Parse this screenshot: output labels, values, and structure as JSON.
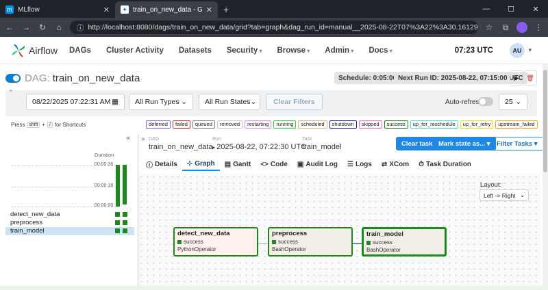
{
  "browser": {
    "tabs": [
      {
        "title": "MLflow",
        "active": false
      },
      {
        "title": "train_on_new_data - Grid - Airfl",
        "active": true
      }
    ],
    "url": "http://localhost:8080/dags/train_on_new_data/grid?tab=graph&dag_run_id=manual__2025-08-22T07%3A22%3A30.161297%2B00%3A00&task_i..."
  },
  "nav": {
    "brand": "Airflow",
    "items": [
      "DAGs",
      "Cluster Activity",
      "Datasets",
      "Security",
      "Browse",
      "Admin",
      "Docs"
    ],
    "dropdown_items": [
      "Security",
      "Browse",
      "Admin",
      "Docs"
    ],
    "time": "07:23 UTC",
    "user_initials": "AU"
  },
  "dag": {
    "label": "DAG:",
    "name": "train_on_new_data",
    "schedule": "Schedule: 0:05:00",
    "next_run": "Next Run ID: 2025-08-22, 07:15:00 UTC"
  },
  "filters": {
    "date": "08/22/2025 07:22:31 AM",
    "run_types": "All Run Types",
    "run_states": "All Run States",
    "clear": "Clear Filters",
    "auto_refresh": "Auto-refresh",
    "page_size": "25"
  },
  "shortcut": {
    "press": "Press",
    "key1": "shift",
    "plus": "+",
    "key2": "/",
    "suffix": "for Shortcuts"
  },
  "legend": [
    {
      "label": "deferred",
      "color": "#7b68ee"
    },
    {
      "label": "failed",
      "color": "#d62728"
    },
    {
      "label": "queued",
      "color": "#808080"
    },
    {
      "label": "removed",
      "color": "#c8c8c8"
    },
    {
      "label": "restarting",
      "color": "#ee82ee"
    },
    {
      "label": "running",
      "color": "#32cd32"
    },
    {
      "label": "scheduled",
      "color": "#d2b48c"
    },
    {
      "label": "shutdown",
      "color": "#1a1ab0"
    },
    {
      "label": "skipped",
      "color": "#ff69b4"
    },
    {
      "label": "success",
      "color": "#1a8a1a"
    },
    {
      "label": "up_for_reschedule",
      "color": "#40e0d0"
    },
    {
      "label": "up_for_retry",
      "color": "#ffd700"
    },
    {
      "label": "upstream_failed",
      "color": "#ffa500"
    },
    {
      "label": "no_status",
      "color": ""
    }
  ],
  "grid": {
    "duration_label": "Duration",
    "ticks": [
      "00:00:36",
      "00:00:18",
      "00:00:00"
    ],
    "tasks": [
      "detect_new_data",
      "preprocess",
      "train_model"
    ],
    "selected_task": "train_model",
    "run_count": 2
  },
  "details": {
    "crumbs": [
      {
        "label": "DAG",
        "value": "train_on_new_data"
      },
      {
        "label": "Run",
        "value": "2025-08-22, 07:22:30 UTC"
      },
      {
        "label": "Task",
        "value": "train_model"
      }
    ],
    "clear_task": "Clear task",
    "mark_state": "Mark state as...",
    "filter_tasks": "Filter Tasks",
    "tabs": [
      "Details",
      "Graph",
      "Gantt",
      "Code",
      "Audit Log",
      "Logs",
      "XCom",
      "Task Duration"
    ],
    "active_tab": "Graph",
    "layout_label": "Layout:",
    "layout_value": "Left -> Right"
  },
  "graph_nodes": [
    {
      "name": "detect_new_data",
      "status": "success",
      "operator": "PythonOperator"
    },
    {
      "name": "preprocess",
      "status": "success",
      "operator": "BashOperator"
    },
    {
      "name": "train_model",
      "status": "success",
      "operator": "BashOperator"
    }
  ]
}
